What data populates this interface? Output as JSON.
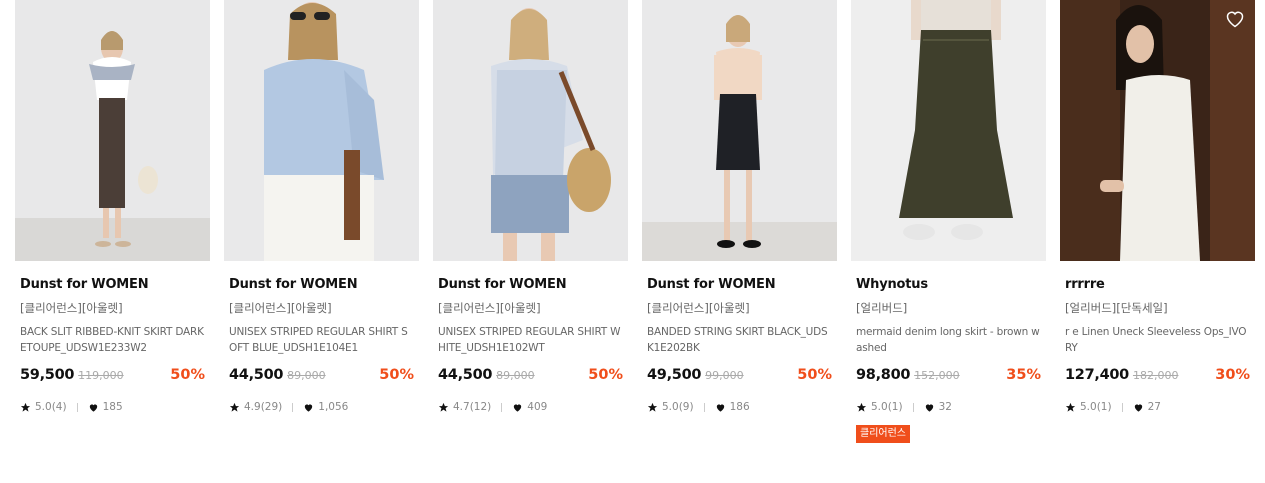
{
  "colors": {
    "accent": "#f04e1b",
    "text": "#111111",
    "muted": "#888888"
  },
  "icons": {
    "wishlist": "heart-outline-icon",
    "rating": "star-icon",
    "likes": "heart-filled-icon"
  },
  "products": [
    {
      "brand": "Dunst for WOMEN",
      "tag": "[클리어런스][아울렛]",
      "name": "BACK SLIT RIBBED-KNIT SKIRT DARK ETOUPE_UDSW1E233W2",
      "price": "59,500",
      "original_price": "119,000",
      "discount": "50%",
      "rating": "5.0(4)",
      "likes": "185",
      "badge": ""
    },
    {
      "brand": "Dunst for WOMEN",
      "tag": "[클리어런스][아울렛]",
      "name": "UNISEX STRIPED REGULAR SHIRT SOFT BLUE_UDSH1E104E1",
      "price": "44,500",
      "original_price": "89,000",
      "discount": "50%",
      "rating": "4.9(29)",
      "likes": "1,056",
      "badge": ""
    },
    {
      "brand": "Dunst for WOMEN",
      "tag": "[클리어런스][아울렛]",
      "name": "UNISEX STRIPED REGULAR SHIRT WHITE_UDSH1E102WT",
      "price": "44,500",
      "original_price": "89,000",
      "discount": "50%",
      "rating": "4.7(12)",
      "likes": "409",
      "badge": ""
    },
    {
      "brand": "Dunst for WOMEN",
      "tag": "[클리어런스][아울렛]",
      "name": "BANDED STRING SKIRT BLACK_UDSK1E202BK",
      "price": "49,500",
      "original_price": "99,000",
      "discount": "50%",
      "rating": "5.0(9)",
      "likes": "186",
      "badge": ""
    },
    {
      "brand": "Whynotus",
      "tag": "[얼리버드]",
      "name": "mermaid denim long skirt - brown washed",
      "price": "98,800",
      "original_price": "152,000",
      "discount": "35%",
      "rating": "5.0(1)",
      "likes": "32",
      "badge": "클리어런스"
    },
    {
      "brand": "rrrrre",
      "tag": "[얼리버드][단독세일]",
      "name": "r e Linen Uneck Sleeveless Ops_IVORY",
      "price": "127,400",
      "original_price": "182,000",
      "discount": "30%",
      "rating": "5.0(1)",
      "likes": "27",
      "badge": ""
    }
  ]
}
